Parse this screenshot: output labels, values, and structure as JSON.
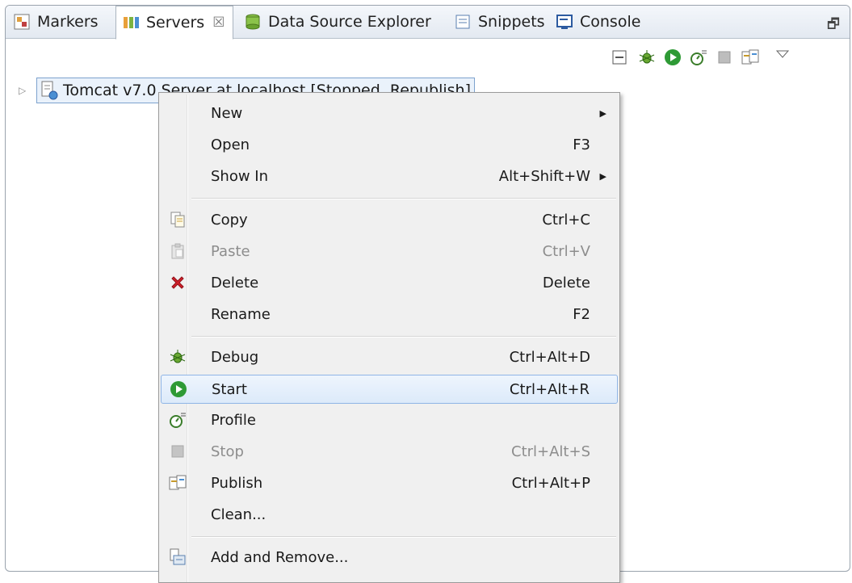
{
  "tabs": [
    {
      "label": "Markers",
      "icon": "markers-icon"
    },
    {
      "label": "Servers",
      "icon": "servers-icon",
      "active": true,
      "close": "☒"
    },
    {
      "label": "Data Source Explorer",
      "icon": "data-source-icon"
    },
    {
      "label": "Snippets",
      "icon": "snippets-icon"
    },
    {
      "label": "Console",
      "icon": "console-icon"
    }
  ],
  "restore_glyph": "🗗",
  "toolbar_icons": [
    "collapse-icon",
    "debug-icon",
    "start-icon",
    "profile-icon",
    "stop-icon",
    "publish-icon",
    "view-menu-icon"
  ],
  "tree": {
    "server_label": "Tomcat v7.0 Server at localhost  [Stopped, Republish]"
  },
  "menu": {
    "items": [
      {
        "label": "New",
        "shortcut": "",
        "submenu": true,
        "icon": ""
      },
      {
        "label": "Open",
        "shortcut": "F3",
        "icon": ""
      },
      {
        "label": "Show In",
        "shortcut": "Alt+Shift+W",
        "submenu": true,
        "icon": ""
      },
      {
        "label": "Copy",
        "shortcut": "Ctrl+C",
        "icon": "copy-icon"
      },
      {
        "label": "Paste",
        "shortcut": "Ctrl+V",
        "icon": "paste-icon",
        "disabled": true
      },
      {
        "label": "Delete",
        "shortcut": "Delete",
        "icon": "delete-icon"
      },
      {
        "label": "Rename",
        "shortcut": "F2",
        "icon": ""
      },
      {
        "label": "Debug",
        "shortcut": "Ctrl+Alt+D",
        "icon": "debug-icon"
      },
      {
        "label": "Start",
        "shortcut": "Ctrl+Alt+R",
        "icon": "start-icon",
        "highlighted": true
      },
      {
        "label": "Profile",
        "shortcut": "",
        "icon": "profile-icon"
      },
      {
        "label": "Stop",
        "shortcut": "Ctrl+Alt+S",
        "icon": "stop-icon",
        "disabled": true
      },
      {
        "label": "Publish",
        "shortcut": "Ctrl+Alt+P",
        "icon": "publish-icon"
      },
      {
        "label": "Clean...",
        "shortcut": "",
        "icon": ""
      },
      {
        "label": "Add and Remove...",
        "shortcut": "",
        "icon": "add-remove-icon"
      }
    ]
  },
  "colors": {
    "accent": "#8fb5e6",
    "start_green": "#2e9a35",
    "delete_red": "#d0202a"
  }
}
